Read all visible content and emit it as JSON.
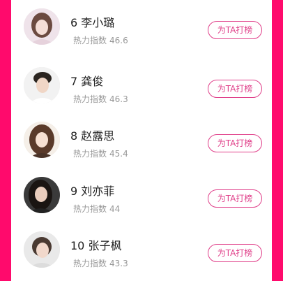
{
  "vote_button_label": "为TA打榜",
  "heat_label": "热力指数",
  "colors": {
    "background": "#ff0a6c",
    "panel": "#ffffff",
    "accent": "#e0408a",
    "name_text": "#222222",
    "muted_text": "#999999"
  },
  "ranking": [
    {
      "name": "6 李小璐",
      "heat": "46.6"
    },
    {
      "name": "7 龚俊",
      "heat": "46.3"
    },
    {
      "name": "8 赵露思",
      "heat": "45.4"
    },
    {
      "name": "9 刘亦菲",
      "heat": "44"
    },
    {
      "name": "10 张子枫",
      "heat": "43.3"
    }
  ]
}
